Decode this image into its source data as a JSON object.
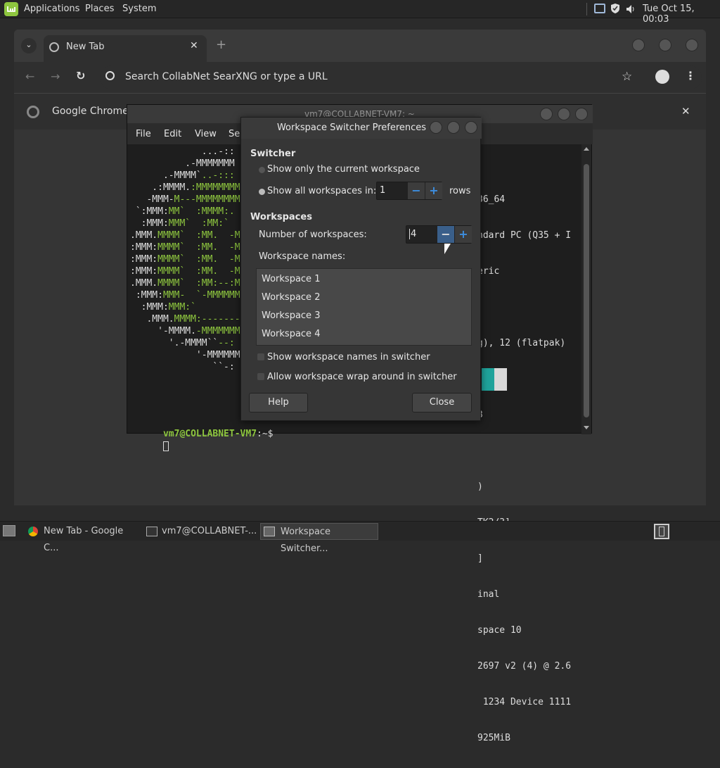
{
  "top_panel": {
    "menus": [
      "Applications",
      "Places",
      "System"
    ],
    "clock": "Tue Oct 15, 00:03",
    "icons": [
      "mint-logo-icon",
      "network-icon",
      "shield-icon",
      "volume-icon"
    ]
  },
  "chrome": {
    "tab_title": "New Tab",
    "new_tab_symbol": "+",
    "omnibox_placeholder": "Search CollabNet SearXNG or type a URL",
    "infobar_text": "Google Chrome is"
  },
  "terminal": {
    "title": "vm7@COLLABNET-VM7: ~",
    "menu": [
      "File",
      "Edit",
      "View",
      "Se"
    ],
    "prompt_user": "vm7@COLLABNET-VM7",
    "prompt_rest": ":~$",
    "right_lines": [
      "36_64",
      "ndard PC (Q35 + I",
      "eric",
      "",
      "g), 12 (flatpak)",
      "",
      "3",
      "",
      ")",
      "TK2/3]",
      "]",
      "inal",
      "space 10",
      "2697 v2 (4) @ 2.6",
      " 1234 Device 1111",
      "925MiB"
    ]
  },
  "dialog": {
    "title": "Workspace Switcher Preferences",
    "switcher_heading": "Switcher",
    "opt_current": "Show only the current workspace",
    "opt_all": "Show all workspaces in:",
    "rows_value": "1",
    "rows_label": "rows",
    "workspaces_heading": "Workspaces",
    "num_label": "Number of workspaces:",
    "num_value": "4",
    "names_label": "Workspace names:",
    "names": [
      "Workspace 1",
      "Workspace 2",
      "Workspace 3",
      "Workspace 4"
    ],
    "show_names": "Show workspace names in switcher",
    "wrap": "Allow workspace wrap around in switcher",
    "help": "Help",
    "close": "Close",
    "minus": "−",
    "plus": "+"
  },
  "taskbar": {
    "items": [
      "New Tab - Google C...",
      "vm7@COLLABNET-...",
      "Workspace Switcher..."
    ]
  },
  "colors": {
    "accent": "#3d8ee0",
    "terminal_green": "#8ec63f",
    "mint": "#8ec63f"
  }
}
